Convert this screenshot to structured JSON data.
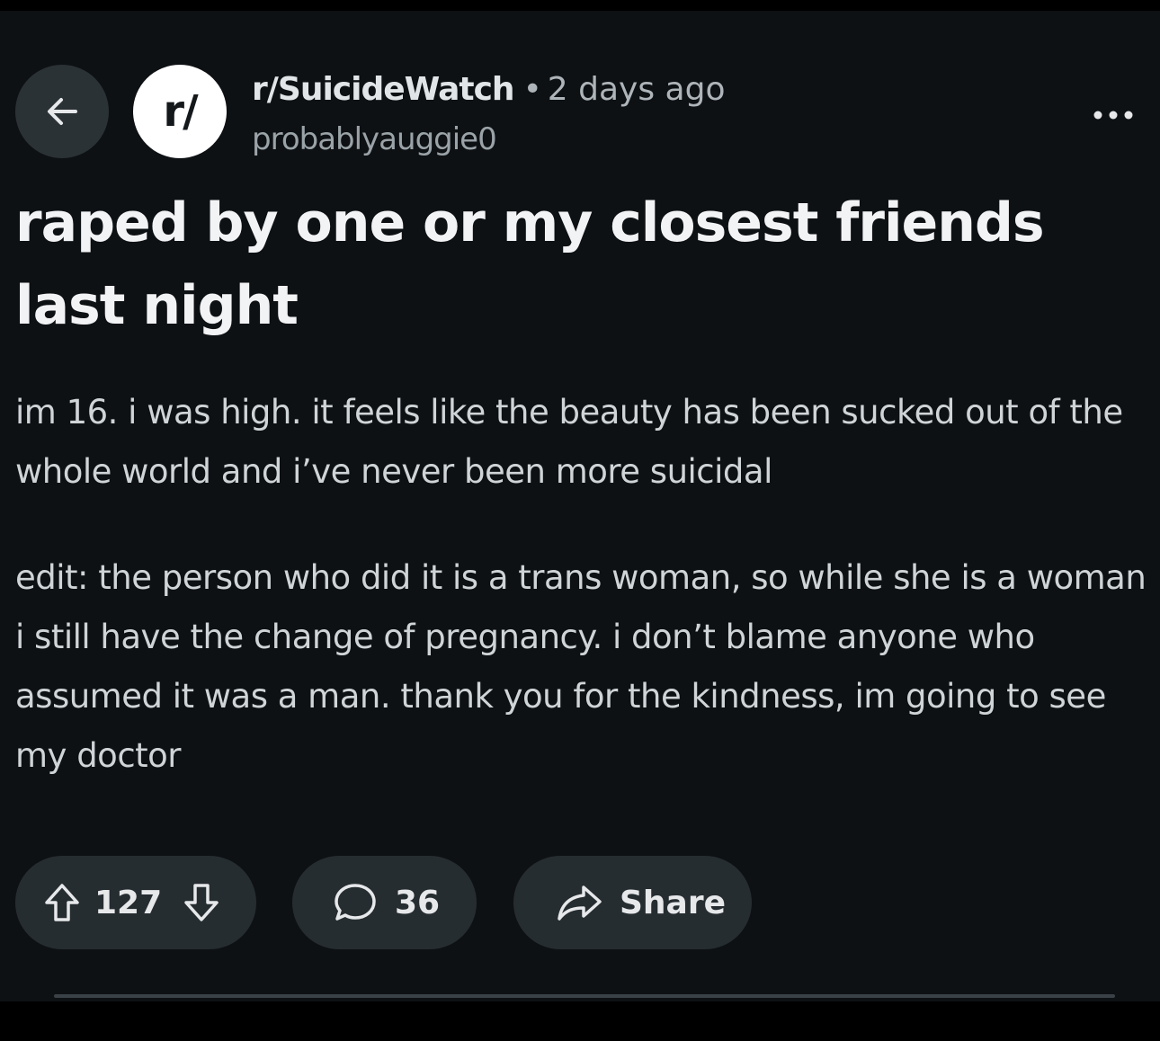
{
  "header": {
    "subreddit": "r/SuicideWatch",
    "separator": "•",
    "time_ago": "2 days ago",
    "author": "probablyauggie0",
    "avatar_text": "r/"
  },
  "post": {
    "title": "raped by one or my closest friends last night",
    "body_paragraph_1": "im 16. i was high. it feels like the beauty has been sucked out of the whole world and i’ve never been more suicidal",
    "body_paragraph_2": "edit: the person who did it is a trans woman, so while she is a woman i still have the change of pregnancy. i don’t blame anyone who assumed it was a man. thank you for the kindness, im going to see my doctor"
  },
  "actions": {
    "vote_count": "127",
    "comment_count": "36",
    "share_label": "Share"
  },
  "icons": {
    "back": "arrow-left-icon",
    "more": "ellipsis-icon",
    "upvote": "arrow-up-icon",
    "downvote": "arrow-down-icon",
    "comment": "speech-bubble-icon",
    "share": "share-arrow-icon"
  },
  "colors": {
    "background": "#0e1114",
    "pill": "#262d31",
    "title_text": "#f2f3f5",
    "body_text": "#cfd4d7",
    "muted_text": "#9aa3a8"
  }
}
